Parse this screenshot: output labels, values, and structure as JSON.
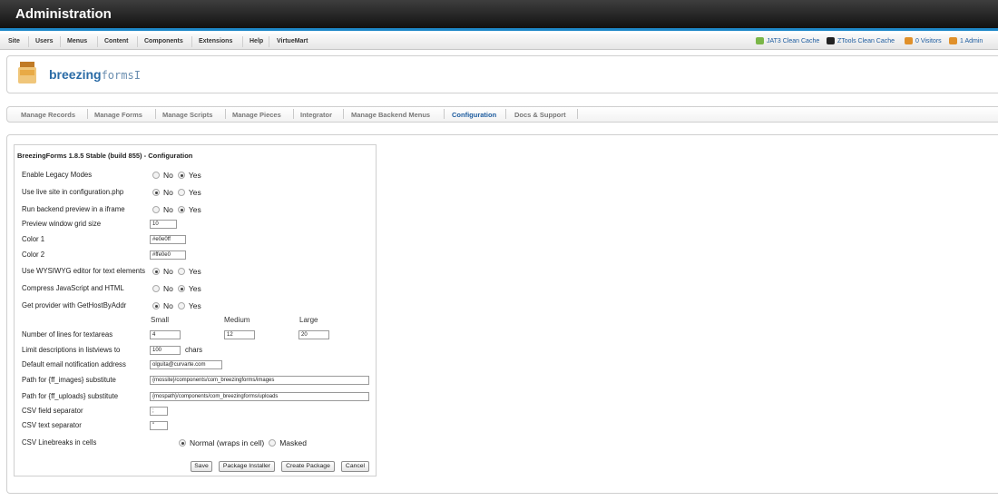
{
  "header": {
    "title": "Administration"
  },
  "menu": {
    "items": [
      "Site",
      "Users",
      "Menus",
      "Content",
      "Components",
      "Extensions",
      "Help",
      "VirtueMart"
    ],
    "right": [
      {
        "label": "JAT3 Clean Cache",
        "icon": "broom-icon"
      },
      {
        "label": "ZTools Clean Cache",
        "icon": "ztools-icon"
      },
      {
        "label": "0 Visitors",
        "icon": "visitors-icon"
      },
      {
        "label": "1 Admin",
        "icon": "admin-user-icon"
      }
    ]
  },
  "logo": {
    "brand_bold": "breezing",
    "brand_light": "forms"
  },
  "tabs": [
    "Manage Records",
    "Manage Forms",
    "Manage Scripts",
    "Manage Pieces",
    "Integrator",
    "Manage Backend Menus",
    "Configuration",
    "Docs & Support"
  ],
  "active_tab": "Configuration",
  "config": {
    "title": "BreezingForms 1.8.5 Stable (build 855) - Configuration",
    "labels": {
      "legacy": "Enable Legacy Modes",
      "live_site": "Use live site in configuration.php",
      "iframe": "Run backend preview in a iframe",
      "grid": "Preview window grid size",
      "color1": "Color 1",
      "color2": "Color 2",
      "wysiwyg": "Use WYSIWYG editor for text elements",
      "compress": "Compress JavaScript and HTML",
      "provider": "Get provider with GetHostByAddr",
      "lines": "Number of lines for textareas",
      "limit": "Limit descriptions in listviews to",
      "email": "Default email notification address",
      "images": "Path for {ff_images} substitute",
      "uploads": "Path for {ff_uploads} substitute",
      "csv_field": "CSV field separator",
      "csv_text": "CSV text separator",
      "csv_lb": "CSV Linebreaks in cells"
    },
    "options": {
      "no": "No",
      "yes": "Yes",
      "normal": "Normal (wraps in cell)",
      "masked": "Masked"
    },
    "values": {
      "legacy": "yes",
      "live_site": "no",
      "iframe": "yes",
      "wysiwyg": "no",
      "compress": "yes",
      "provider": "no",
      "csv_lb": "normal",
      "grid": "10",
      "color1": "#e0e0ff",
      "color2": "#ffe0e0",
      "lines_small": "4",
      "lines_medium": "12",
      "lines_large": "20",
      "limit": "100",
      "email": "olguita@curvarte.com",
      "images": "{mossite}/components/com_breezingforms/images",
      "uploads": "{mospath}/components/com_breezingforms/uploads",
      "csv_field": ";",
      "csv_text": "\""
    },
    "size_headers": {
      "small": "Small",
      "medium": "Medium",
      "large": "Large"
    },
    "chars_label": "chars",
    "buttons": {
      "save": "Save",
      "package_installer": "Package Installer",
      "create_package": "Create Package",
      "cancel": "Cancel"
    }
  }
}
